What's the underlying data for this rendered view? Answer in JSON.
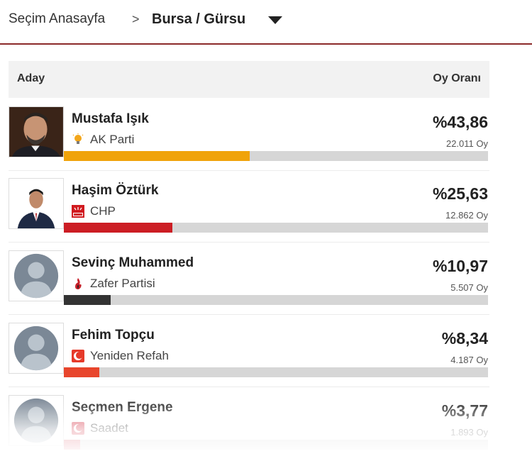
{
  "breadcrumb": {
    "home_label": "Seçim Anasayfa",
    "separator": ">",
    "current_label": "Bursa / Gürsu",
    "dropdown_icon": "caret-down-icon"
  },
  "table": {
    "header": {
      "candidate_label": "Aday",
      "rate_label": "Oy Oranı"
    },
    "rows": [
      {
        "name": "Mustafa Işık",
        "party": "AK Parti",
        "party_logo": "akp-bulb-icon",
        "percent_text": "%43,86",
        "votes_text": "22.011 Oy",
        "share": 43.86,
        "bar_color": "#f0a30a",
        "photo": "candidate-photo"
      },
      {
        "name": "Haşim Öztürk",
        "party": "CHP",
        "party_logo": "chp-arrows-icon",
        "percent_text": "%25,63",
        "votes_text": "12.862 Oy",
        "share": 25.63,
        "bar_color": "#cc1d24",
        "photo": "candidate-photo"
      },
      {
        "name": "Sevinç Muhammed",
        "party": "Zafer Partisi",
        "party_logo": "zafer-flame-icon",
        "percent_text": "%10,97",
        "votes_text": "5.507 Oy",
        "share": 10.97,
        "bar_color": "#333333",
        "photo": "placeholder-avatar"
      },
      {
        "name": "Fehim Topçu",
        "party": "Yeniden Refah",
        "party_logo": "yeniden-refah-crescent-icon",
        "percent_text": "%8,34",
        "votes_text": "4.187 Oy",
        "share": 8.34,
        "bar_color": "#e8452c",
        "photo": "placeholder-avatar"
      },
      {
        "name": "Seçmen Ergene",
        "party": "Saadet",
        "party_logo": "saadet-crescent-icon",
        "percent_text": "%3,77",
        "votes_text": "1.893 Oy",
        "share": 3.77,
        "bar_color": "#d94a5a",
        "photo": "placeholder-avatar"
      }
    ]
  }
}
